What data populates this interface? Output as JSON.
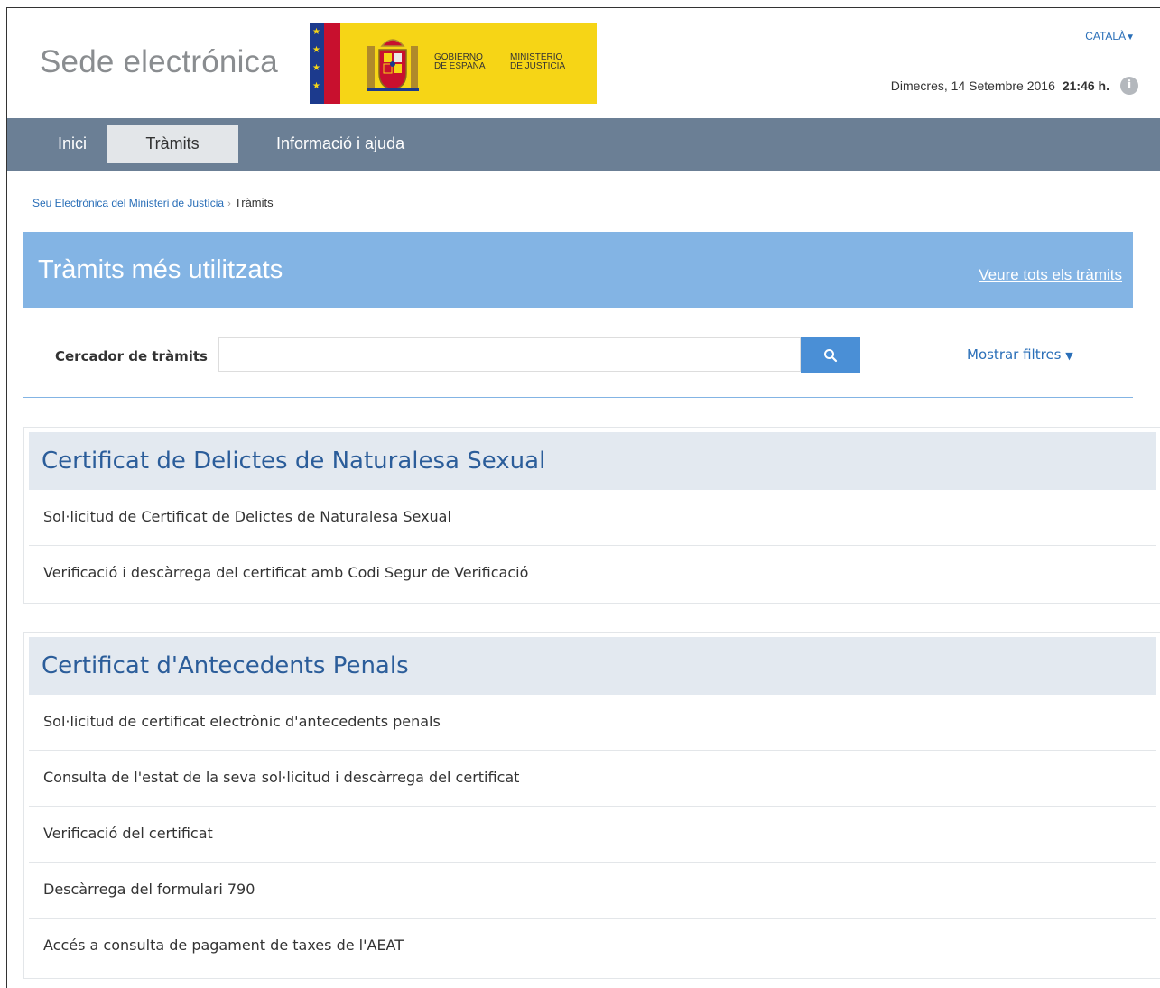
{
  "header": {
    "site_title": "Sede electrónica",
    "logo": {
      "text_left": "GOBIERNO DE ESPAÑA",
      "text_right": "MINISTERIO DE JUSTICIA",
      "bg_color": "#f6d516"
    },
    "language": "CATALÀ",
    "date": "Dimecres, 14 Setembre 2016",
    "time": "21:46 h.",
    "info_icon": "info-icon"
  },
  "nav": {
    "tabs": [
      {
        "label": "Inici"
      },
      {
        "label": "Tràmits",
        "active": true
      },
      {
        "label": "Informació i ajuda"
      }
    ],
    "bg_color": "#6b7f95"
  },
  "breadcrumb": {
    "parent": "Seu Electrònica del Ministeri de Justícia",
    "separator": "›",
    "current": "Tràmits"
  },
  "banner": {
    "title": "Tràmits més utilitzats",
    "link": "Veure tots els tràmits",
    "bg_color": "#83b4e4"
  },
  "search": {
    "label": "Cercador de tràmits",
    "placeholder": "",
    "button_icon": "search-icon",
    "filters_label": "Mostrar filtres"
  },
  "groups": [
    {
      "title": "Certificat de Delictes de Naturalesa Sexual",
      "items": [
        "Sol·licitud de Certificat de Delictes de Naturalesa Sexual",
        "Verificació i descàrrega del certificat amb Codi Segur de Verificació"
      ]
    },
    {
      "title": "Certificat d'Antecedents Penals",
      "items": [
        "Sol·licitud de certificat electrònic d'antecedents penals",
        "Consulta de l'estat de la seva sol·licitud i descàrrega del certificat",
        "Verificació del certificat",
        "Descàrrega del formulari 790",
        "Accés a consulta de pagament de taxes de l'AEAT"
      ]
    }
  ]
}
